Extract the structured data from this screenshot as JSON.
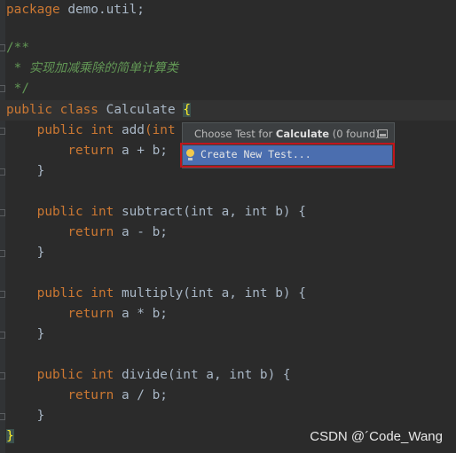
{
  "editor": {
    "package_kw": "package",
    "package_name": " demo.util;",
    "doc_open": "/**",
    "doc_line_prefix": " * ",
    "doc_text": "实现加减乘除的简单计算类",
    "doc_close": " */",
    "class_decl": {
      "public": "public",
      "class": "class",
      "name": "Calculate",
      "brace": "{"
    },
    "methods": [
      {
        "name": "add",
        "params_visible": "(int",
        "body": "a + b;"
      },
      {
        "name": "subtract",
        "params": "(int a, int b) {",
        "body": "a - b;"
      },
      {
        "name": "multiply",
        "params": "(int a, int b) {",
        "body": "a * b;"
      },
      {
        "name": "divide",
        "params": "(int a, int b) {",
        "body": "a / b;"
      }
    ],
    "kw_public": "public",
    "kw_int": "int",
    "kw_return": "return",
    "close_brace": "}"
  },
  "popup": {
    "title_prefix": "Choose Test for ",
    "title_class": "Calculate",
    "title_suffix": " (0 found)",
    "pin_icon": "pin-window-icon",
    "items": [
      {
        "label": "Create New Test...",
        "icon": "lightbulb-icon",
        "selected": true
      }
    ]
  },
  "watermark": "CSDN @´Code_Wang"
}
